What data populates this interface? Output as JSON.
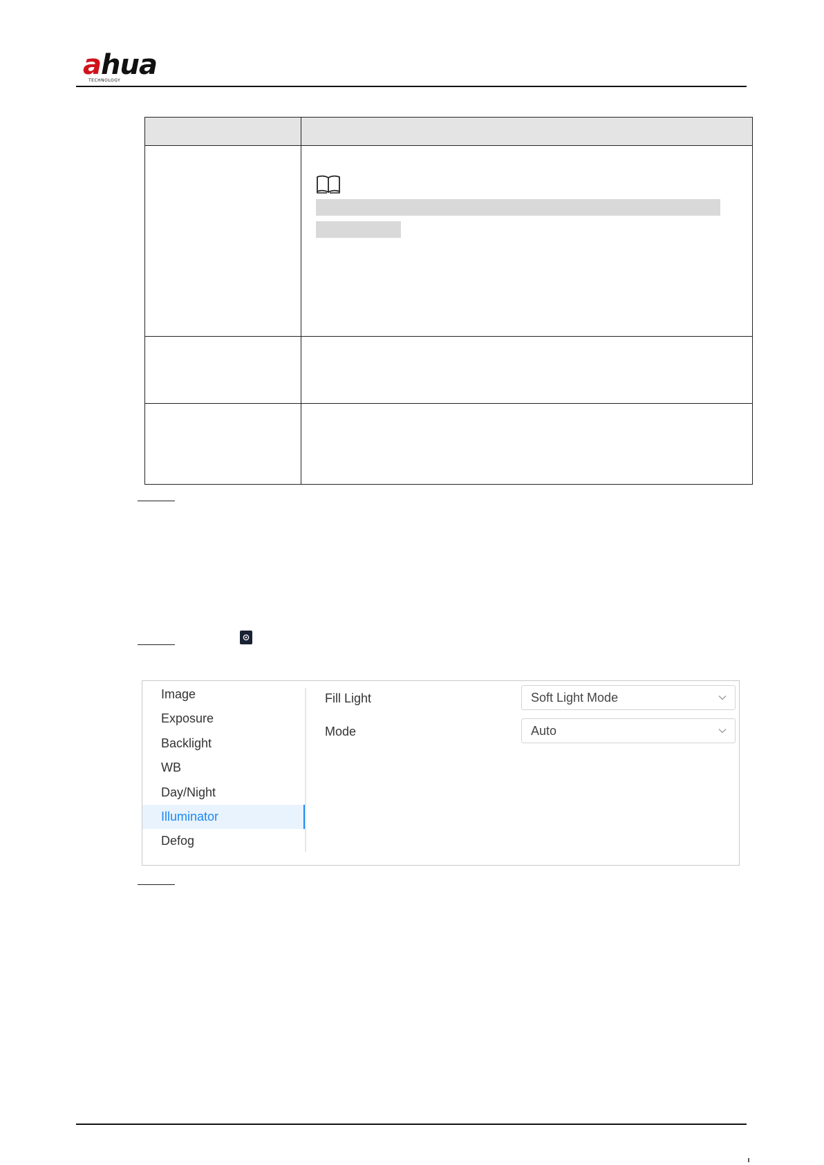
{
  "header": {
    "logo_text_left": "a",
    "logo_text_right": "hua",
    "logo_subtext": "TECHNOLOGY"
  },
  "icons": {
    "note": "book-icon",
    "settings": "gear-icon",
    "dropdown": "chevron-down-icon"
  },
  "colors": {
    "accent": "#1e87f0",
    "active_bg": "#e8f3fd",
    "table_header_bg": "#e4e4e4",
    "redaction": "#d9d9d9",
    "brand_red": "#d0121b"
  },
  "settings_panel": {
    "nav_items": [
      {
        "label": "Image"
      },
      {
        "label": "Exposure"
      },
      {
        "label": "Backlight"
      },
      {
        "label": "WB"
      },
      {
        "label": "Day/Night"
      },
      {
        "label": "Illuminator"
      },
      {
        "label": "Defog"
      }
    ],
    "active_item": "Illuminator",
    "fields": [
      {
        "label": "Fill Light",
        "value": "Soft Light Mode"
      },
      {
        "label": "Mode",
        "value": "Auto"
      }
    ]
  }
}
